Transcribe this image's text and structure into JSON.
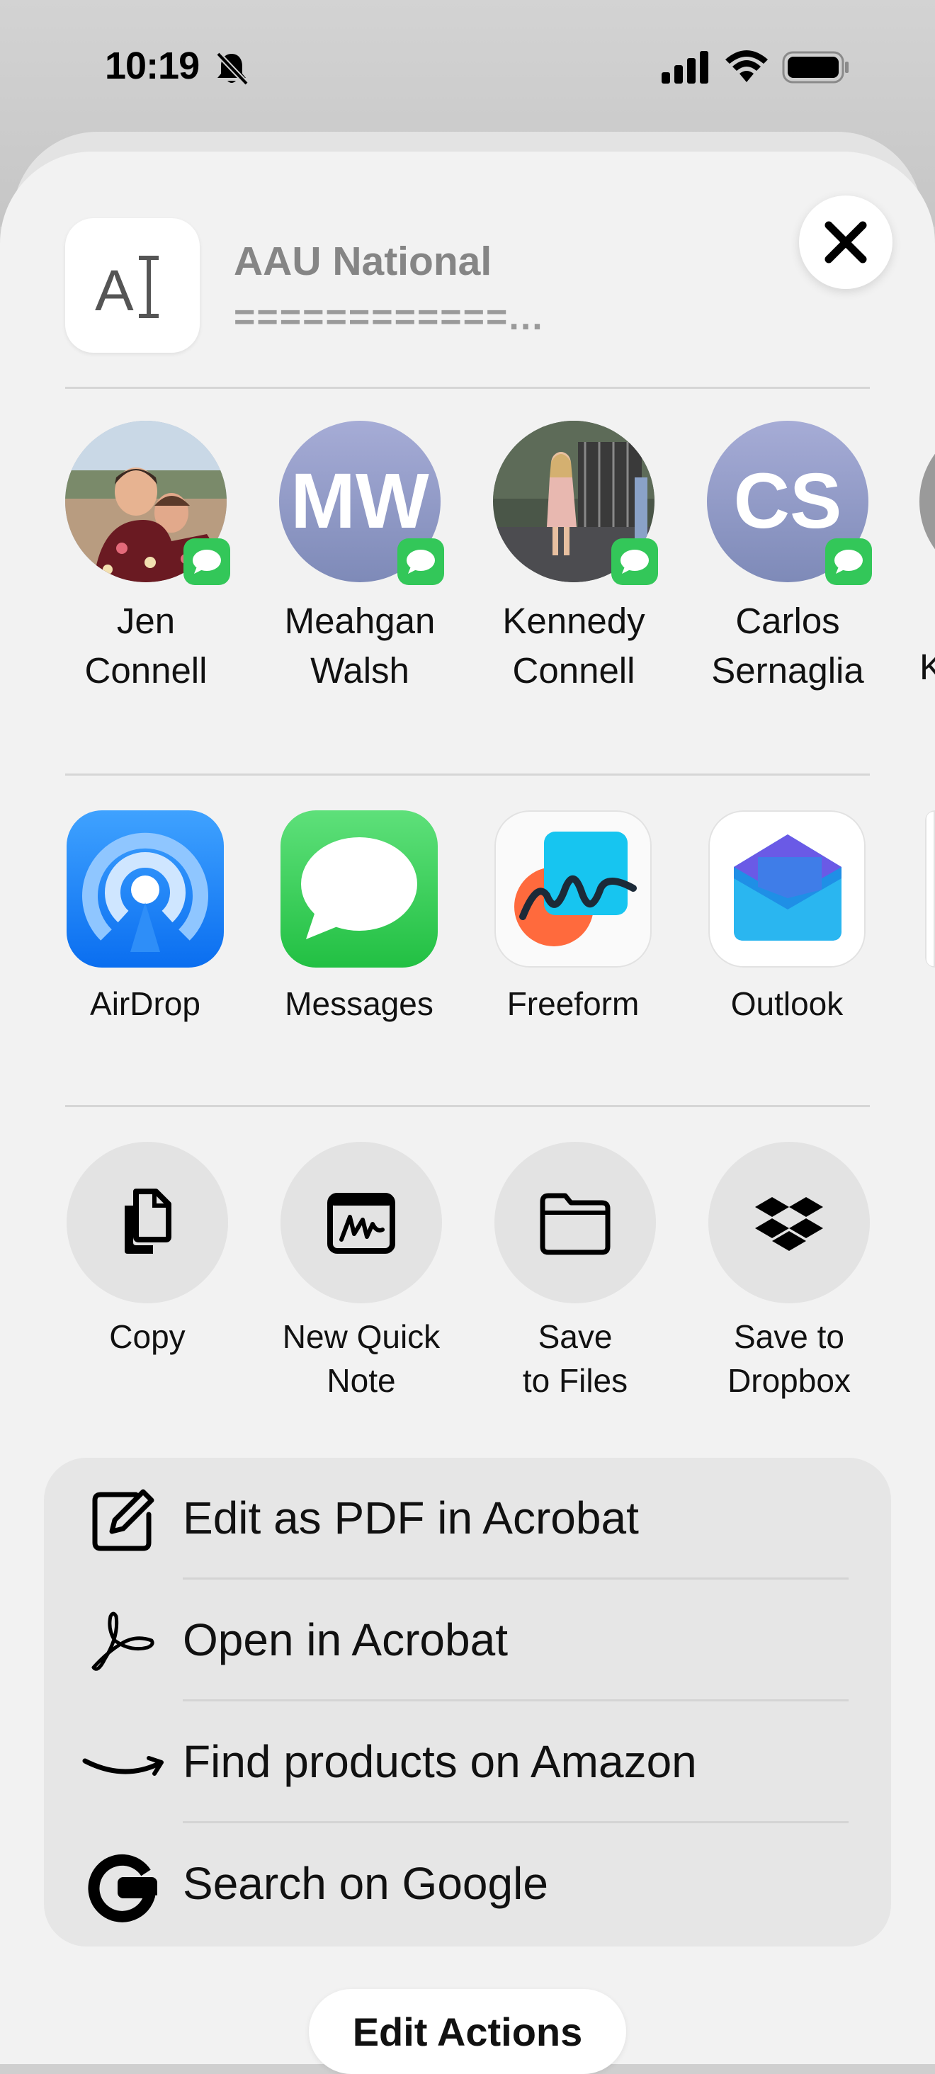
{
  "status_bar": {
    "time": "10:19"
  },
  "header": {
    "title": "AAU National",
    "subtitle": "============...",
    "doc_icon": "text-cursor-icon",
    "close_icon": "close-icon"
  },
  "contacts": [
    {
      "first": "Jen",
      "last": "Connell",
      "avatar": "photo"
    },
    {
      "first": "Meahgan",
      "last": "Walsh",
      "avatar": "initials",
      "initials": "MW"
    },
    {
      "first": "Kennedy",
      "last": "Connell",
      "avatar": "photo"
    },
    {
      "first": "Carlos",
      "last": "Sernaglia",
      "avatar": "initials",
      "initials": "CS"
    },
    {
      "first": "",
      "last": "K",
      "avatar": "photo"
    }
  ],
  "apps": [
    {
      "label": "AirDrop",
      "icon": "airdrop-icon"
    },
    {
      "label": "Messages",
      "icon": "messages-icon"
    },
    {
      "label": "Freeform",
      "icon": "freeform-icon"
    },
    {
      "label": "Outlook",
      "icon": "outlook-icon"
    }
  ],
  "actions": [
    {
      "line1": "Copy",
      "line2": "",
      "icon": "copy-icon"
    },
    {
      "line1": "New Quick",
      "line2": "Note",
      "icon": "quick-note-icon"
    },
    {
      "line1": "Save",
      "line2": "to Files",
      "icon": "folder-icon"
    },
    {
      "line1": "Save to",
      "line2": "Dropbox",
      "icon": "dropbox-icon"
    }
  ],
  "list": [
    {
      "label": "Edit as PDF in Acrobat",
      "icon": "edit-pdf-icon"
    },
    {
      "label": "Open in Acrobat",
      "icon": "acrobat-icon"
    },
    {
      "label": "Find products on Amazon",
      "icon": "amazon-icon"
    },
    {
      "label": "Search on Google",
      "icon": "google-icon"
    }
  ],
  "footer": {
    "edit_actions": "Edit Actions"
  },
  "colors": {
    "sheet": "#f2f2f2",
    "imessage_green": "#33c759",
    "airdrop_blue": "#1a7ff5"
  }
}
